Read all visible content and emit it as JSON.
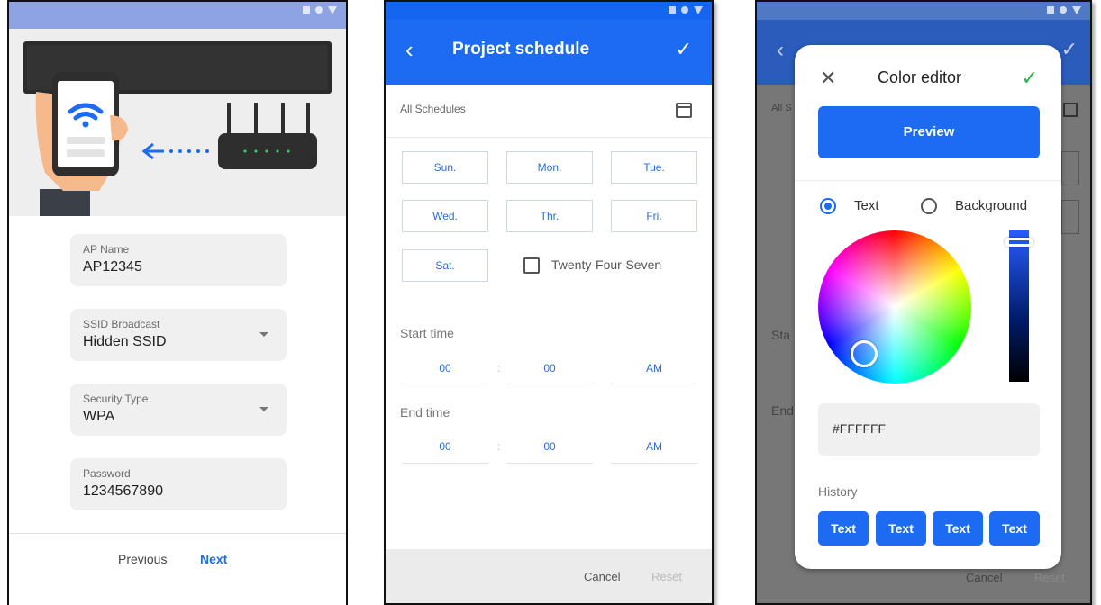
{
  "wifi_setup": {
    "fields": [
      {
        "label": "AP Name",
        "value": "AP12345"
      },
      {
        "label": "SSID Broadcast",
        "value": "Hidden SSID"
      },
      {
        "label": "Security Type",
        "value": "WPA"
      },
      {
        "label": "Password",
        "value": "1234567890"
      }
    ],
    "previous_label": "Previous",
    "next_label": "Next"
  },
  "schedule": {
    "title": "Project schedule",
    "back_glyph": "‹",
    "confirm_glyph": "✓",
    "all_schedules_label": "All Schedules",
    "days": [
      "Sun.",
      "Mon.",
      "Tue.",
      "Wed.",
      "Thr.",
      "Fri.",
      "Sat."
    ],
    "twenty_four_seven_label": "Twenty-Four-Seven",
    "start_time": {
      "label": "Start time",
      "hour": "00",
      "minute": "00",
      "period": "AM",
      "separator": ":"
    },
    "end_time": {
      "label": "End time",
      "hour": "00",
      "minute": "00",
      "period": "AM",
      "separator": ":"
    },
    "cancel_label": "Cancel",
    "reset_label": "Reset"
  },
  "color_editor": {
    "title": "Color editor",
    "close_glyph": "✕",
    "confirm_glyph": "✓",
    "preview_label": "Preview",
    "radio_text_label": "Text",
    "radio_background_label": "Background",
    "hex_value": "#FFFFFF",
    "history_label": "History",
    "history_items": [
      "Text",
      "Text",
      "Text",
      "Text"
    ],
    "background": {
      "all_prefix": "All S",
      "start_prefix": "Sta",
      "end_prefix": "End",
      "cancel_label": "Cancel",
      "reset_label": "Reset",
      "back_glyph": "‹",
      "confirm_glyph": "✓"
    }
  },
  "colors": {
    "primary_blue": "#1c6bf2",
    "confirm_green": "#26b34a",
    "field_bg": "#f0f0f1"
  }
}
